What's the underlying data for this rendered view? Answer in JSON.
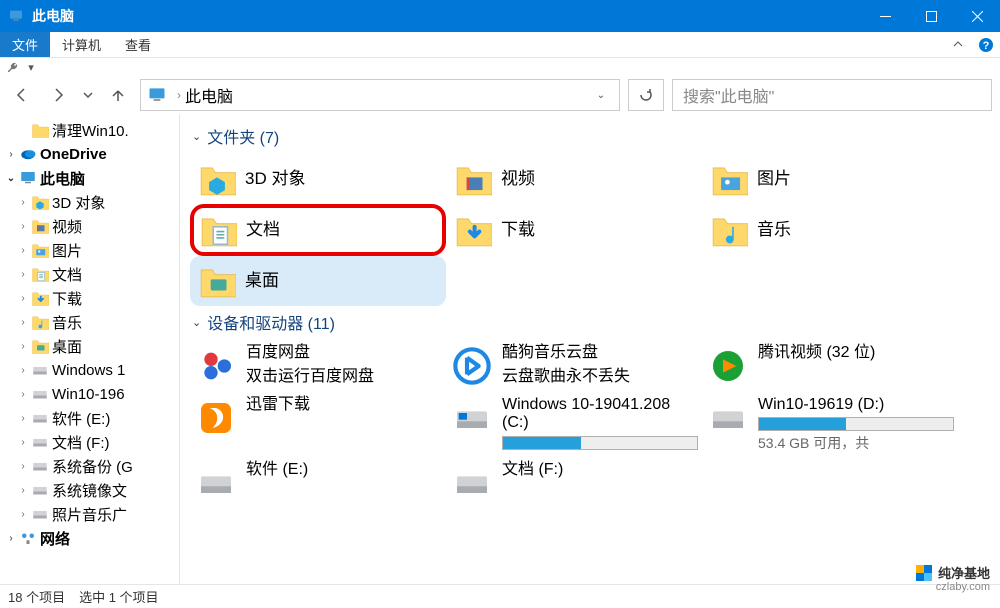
{
  "window": {
    "title": "此电脑"
  },
  "menu": {
    "file": "文件",
    "computer": "计算机",
    "view": "查看"
  },
  "address": {
    "location": "此电脑"
  },
  "search": {
    "placeholder": "搜索\"此电脑\""
  },
  "tree": {
    "items": [
      {
        "label": "清理Win10.",
        "level": 2,
        "arrow": "",
        "icon": "folder"
      },
      {
        "label": "OneDrive",
        "level": 1,
        "arrow": "›",
        "icon": "onedrive"
      },
      {
        "label": "此电脑",
        "level": 1,
        "arrow": "⌄",
        "icon": "pc",
        "selected": true
      },
      {
        "label": "3D 对象",
        "level": 2,
        "arrow": "›",
        "icon": "3d"
      },
      {
        "label": "视频",
        "level": 2,
        "arrow": "›",
        "icon": "video"
      },
      {
        "label": "图片",
        "level": 2,
        "arrow": "›",
        "icon": "pictures"
      },
      {
        "label": "文档",
        "level": 2,
        "arrow": "›",
        "icon": "documents"
      },
      {
        "label": "下载",
        "level": 2,
        "arrow": "›",
        "icon": "downloads"
      },
      {
        "label": "音乐",
        "level": 2,
        "arrow": "›",
        "icon": "music"
      },
      {
        "label": "桌面",
        "level": 2,
        "arrow": "›",
        "icon": "desktop"
      },
      {
        "label": "Windows 1",
        "level": 2,
        "arrow": "›",
        "icon": "disk"
      },
      {
        "label": "Win10-196",
        "level": 2,
        "arrow": "›",
        "icon": "disk"
      },
      {
        "label": "软件 (E:)",
        "level": 2,
        "arrow": "›",
        "icon": "disk"
      },
      {
        "label": "文档 (F:)",
        "level": 2,
        "arrow": "›",
        "icon": "disk"
      },
      {
        "label": "系统备份 (G",
        "level": 2,
        "arrow": "›",
        "icon": "disk"
      },
      {
        "label": "系统镜像文",
        "level": 2,
        "arrow": "›",
        "icon": "disk"
      },
      {
        "label": "照片音乐广",
        "level": 2,
        "arrow": "›",
        "icon": "disk"
      },
      {
        "label": "网络",
        "level": 1,
        "arrow": "›",
        "icon": "network"
      }
    ]
  },
  "sections": {
    "folders": {
      "title": "文件夹 (7)"
    },
    "drives": {
      "title": "设备和驱动器 (11)"
    }
  },
  "folders": [
    {
      "label": "3D 对象",
      "icon": "3d"
    },
    {
      "label": "视频",
      "icon": "video"
    },
    {
      "label": "图片",
      "icon": "pictures"
    },
    {
      "label": "文档",
      "icon": "documents",
      "highlight": true
    },
    {
      "label": "下载",
      "icon": "downloads"
    },
    {
      "label": "音乐",
      "icon": "music"
    },
    {
      "label": "桌面",
      "icon": "desktop",
      "selected": true
    }
  ],
  "drives": [
    {
      "name": "百度网盘",
      "sub": "双击运行百度网盘",
      "icon": "baidu"
    },
    {
      "name": "酷狗音乐云盘",
      "sub": "云盘歌曲永不丢失",
      "icon": "kugou"
    },
    {
      "name": "腾讯视频 (32 位)",
      "sub": "",
      "icon": "tencent"
    },
    {
      "name": "迅雷下载",
      "sub": "",
      "icon": "xunlei"
    },
    {
      "name": "Windows 10-19041.208 (C:)",
      "fill": 40,
      "icon": "osdisk"
    },
    {
      "name": "Win10-19619 (D:)",
      "fill": 45,
      "free": "53.4 GB 可用，共 ",
      "icon": "disk"
    },
    {
      "name": "软件 (E:)",
      "icon": "disk",
      "partial": true
    },
    {
      "name": "文档 (F:)",
      "icon": "disk",
      "partial": true
    }
  ],
  "status": {
    "count": "18 个项目",
    "selected": "选中 1 个项目"
  },
  "watermark": {
    "text": "纯净基地",
    "sub": "czlaby.com"
  }
}
